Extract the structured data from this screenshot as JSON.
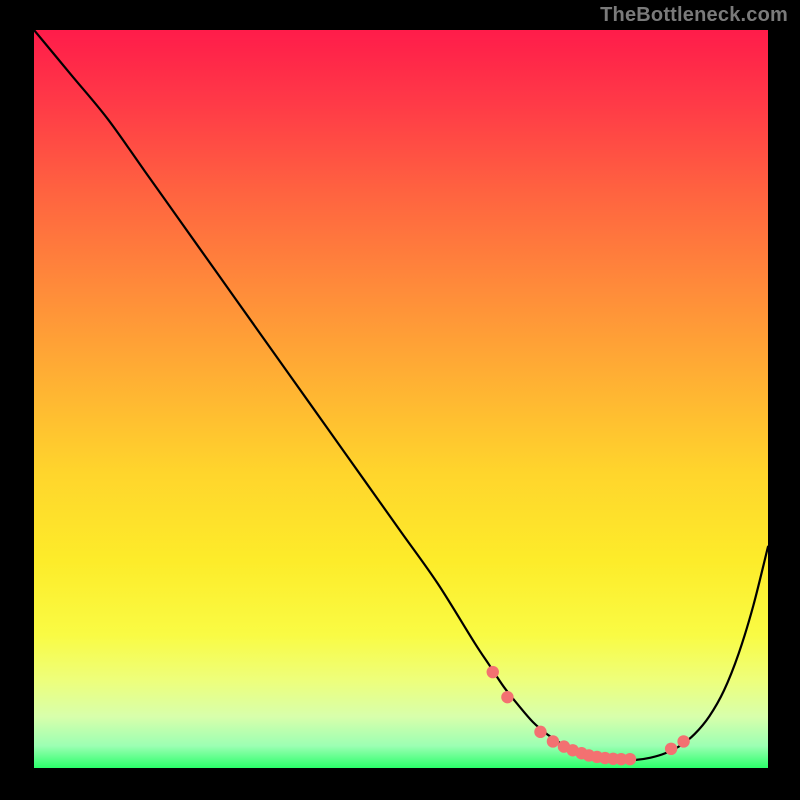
{
  "attribution": "TheBottleneck.com",
  "chart_data": {
    "type": "line",
    "title": "",
    "xlabel": "",
    "ylabel": "",
    "xlim": [
      0,
      100
    ],
    "ylim": [
      0,
      100
    ],
    "series": [
      {
        "name": "bottleneck-curve",
        "x": [
          0,
          5,
          10,
          15,
          20,
          25,
          30,
          35,
          40,
          45,
          50,
          55,
          60,
          62,
          64,
          66,
          68,
          70,
          72,
          74,
          76,
          78,
          80,
          82,
          84,
          86,
          88,
          90,
          92,
          94,
          96,
          98,
          100
        ],
        "y": [
          100,
          94,
          88,
          81,
          74,
          67,
          60,
          53,
          46,
          39,
          32,
          25,
          17,
          14,
          11,
          8.5,
          6.2,
          4.5,
          3.2,
          2.3,
          1.7,
          1.3,
          1.1,
          1.1,
          1.4,
          2.0,
          3.0,
          4.6,
          7.0,
          10.5,
          15.5,
          22,
          30
        ]
      }
    ],
    "markers": {
      "name": "optimal-zone-dots",
      "color": "#f37171",
      "points": [
        {
          "x": 62.5,
          "y": 13.0
        },
        {
          "x": 64.5,
          "y": 9.6
        },
        {
          "x": 69.0,
          "y": 4.9
        },
        {
          "x": 70.7,
          "y": 3.6
        },
        {
          "x": 72.2,
          "y": 2.9
        },
        {
          "x": 73.4,
          "y": 2.4
        },
        {
          "x": 74.6,
          "y": 2.0
        },
        {
          "x": 75.6,
          "y": 1.7
        },
        {
          "x": 76.7,
          "y": 1.5
        },
        {
          "x": 77.8,
          "y": 1.35
        },
        {
          "x": 78.9,
          "y": 1.25
        },
        {
          "x": 80.0,
          "y": 1.2
        },
        {
          "x": 81.2,
          "y": 1.2
        },
        {
          "x": 86.8,
          "y": 2.6
        },
        {
          "x": 88.5,
          "y": 3.6
        }
      ]
    },
    "gradient": {
      "description": "Vertical red-to-green heatmap background indicating bottleneck severity",
      "stops": [
        {
          "pos": 0.0,
          "color": "#ff1c4a"
        },
        {
          "pos": 0.35,
          "color": "#ff8b3a"
        },
        {
          "pos": 0.6,
          "color": "#ffd52c"
        },
        {
          "pos": 0.82,
          "color": "#f9fb44"
        },
        {
          "pos": 0.97,
          "color": "#9cffb3"
        },
        {
          "pos": 1.0,
          "color": "#2bff6a"
        }
      ]
    }
  }
}
